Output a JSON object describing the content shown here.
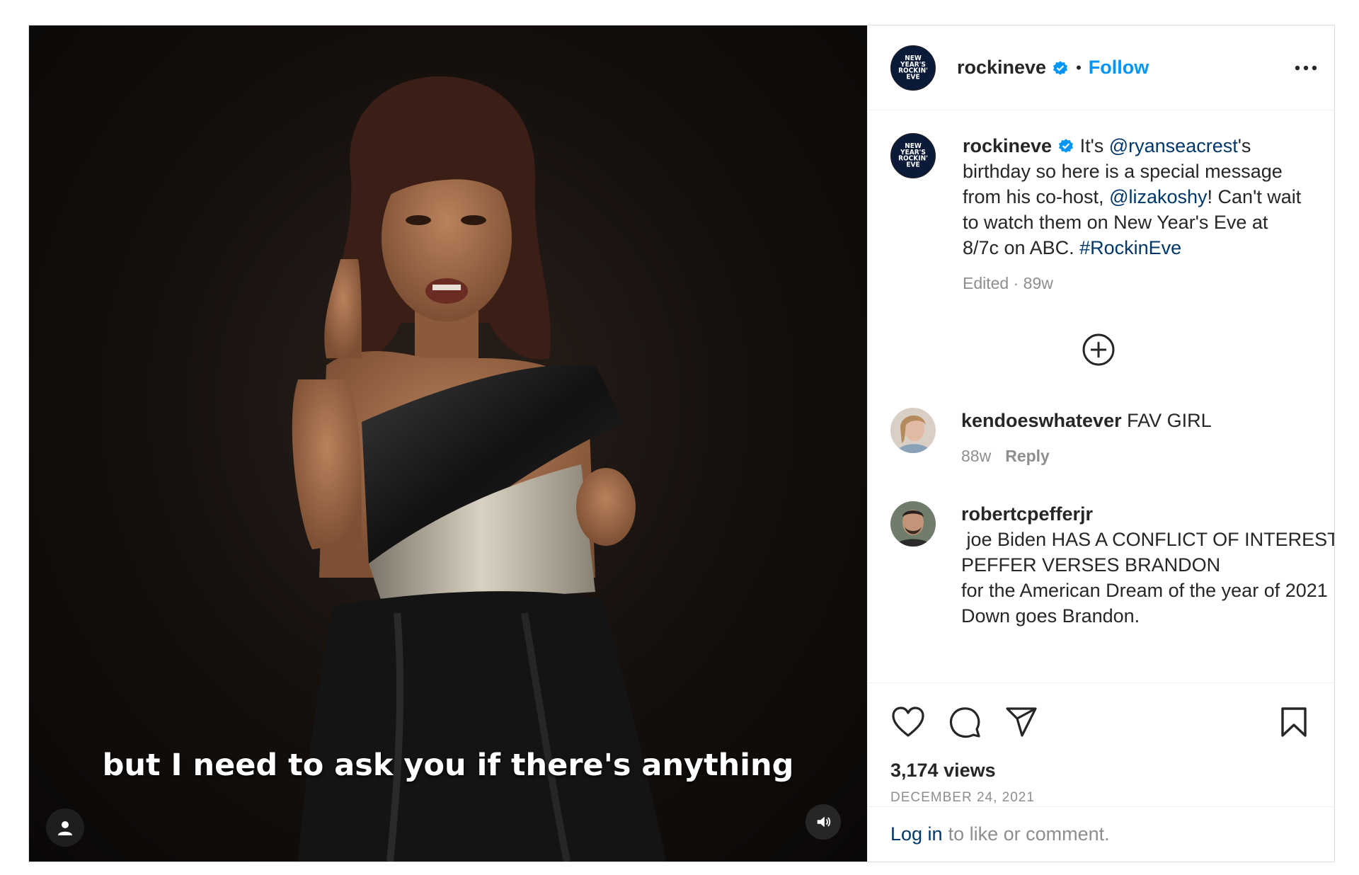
{
  "video": {
    "caption": "but I need to ask you if there's anything"
  },
  "account": {
    "username": "rockineve",
    "avatar_logo_text": "NEW YEAR'S ROCKIN' EVE",
    "follow_label": "Follow",
    "separator": "•"
  },
  "post_caption": {
    "username": "rockineve",
    "text_1": " It's ",
    "mention_1": "@ryanseacrest",
    "text_2": "'s birthday so here is a special message from his co-host, ",
    "mention_2": "@lizakoshy",
    "text_3": "! Can't wait to watch them on New Year's Eve at 8/7c on ABC. ",
    "hashtag": "#RockinEve",
    "meta": "Edited · 89w"
  },
  "comments": [
    {
      "username": "kendoeswhatever",
      "text": " FAV GIRL",
      "age": "88w",
      "reply_label": "Reply"
    },
    {
      "username": "robertcpefferjr",
      "text": " joe Biden HAS A CONFLICT OF INTEREST.",
      "line_2": "PEFFER VERSES BRANDON",
      "line_3": "for the American Dream of the year of 2021",
      "line_4": "Down goes Brandon."
    }
  ],
  "engagement": {
    "views": "3,174 views",
    "date": "DECEMBER 24, 2021"
  },
  "login_prompt": {
    "link": "Log in",
    "rest": "to like or comment."
  },
  "icons": {
    "verified": "verified-badge-icon",
    "more": "more-options-icon",
    "load_more": "load-more-comments-icon",
    "like": "heart-icon",
    "comment": "comment-icon",
    "share": "share-icon",
    "save": "bookmark-icon",
    "tags": "user-tag-icon",
    "audio": "volume-icon"
  },
  "colors": {
    "link_blue": "#0095f6",
    "mention_blue": "#00376b",
    "muted_text": "#8e8e8e",
    "verified_blue": "#0095f6"
  }
}
